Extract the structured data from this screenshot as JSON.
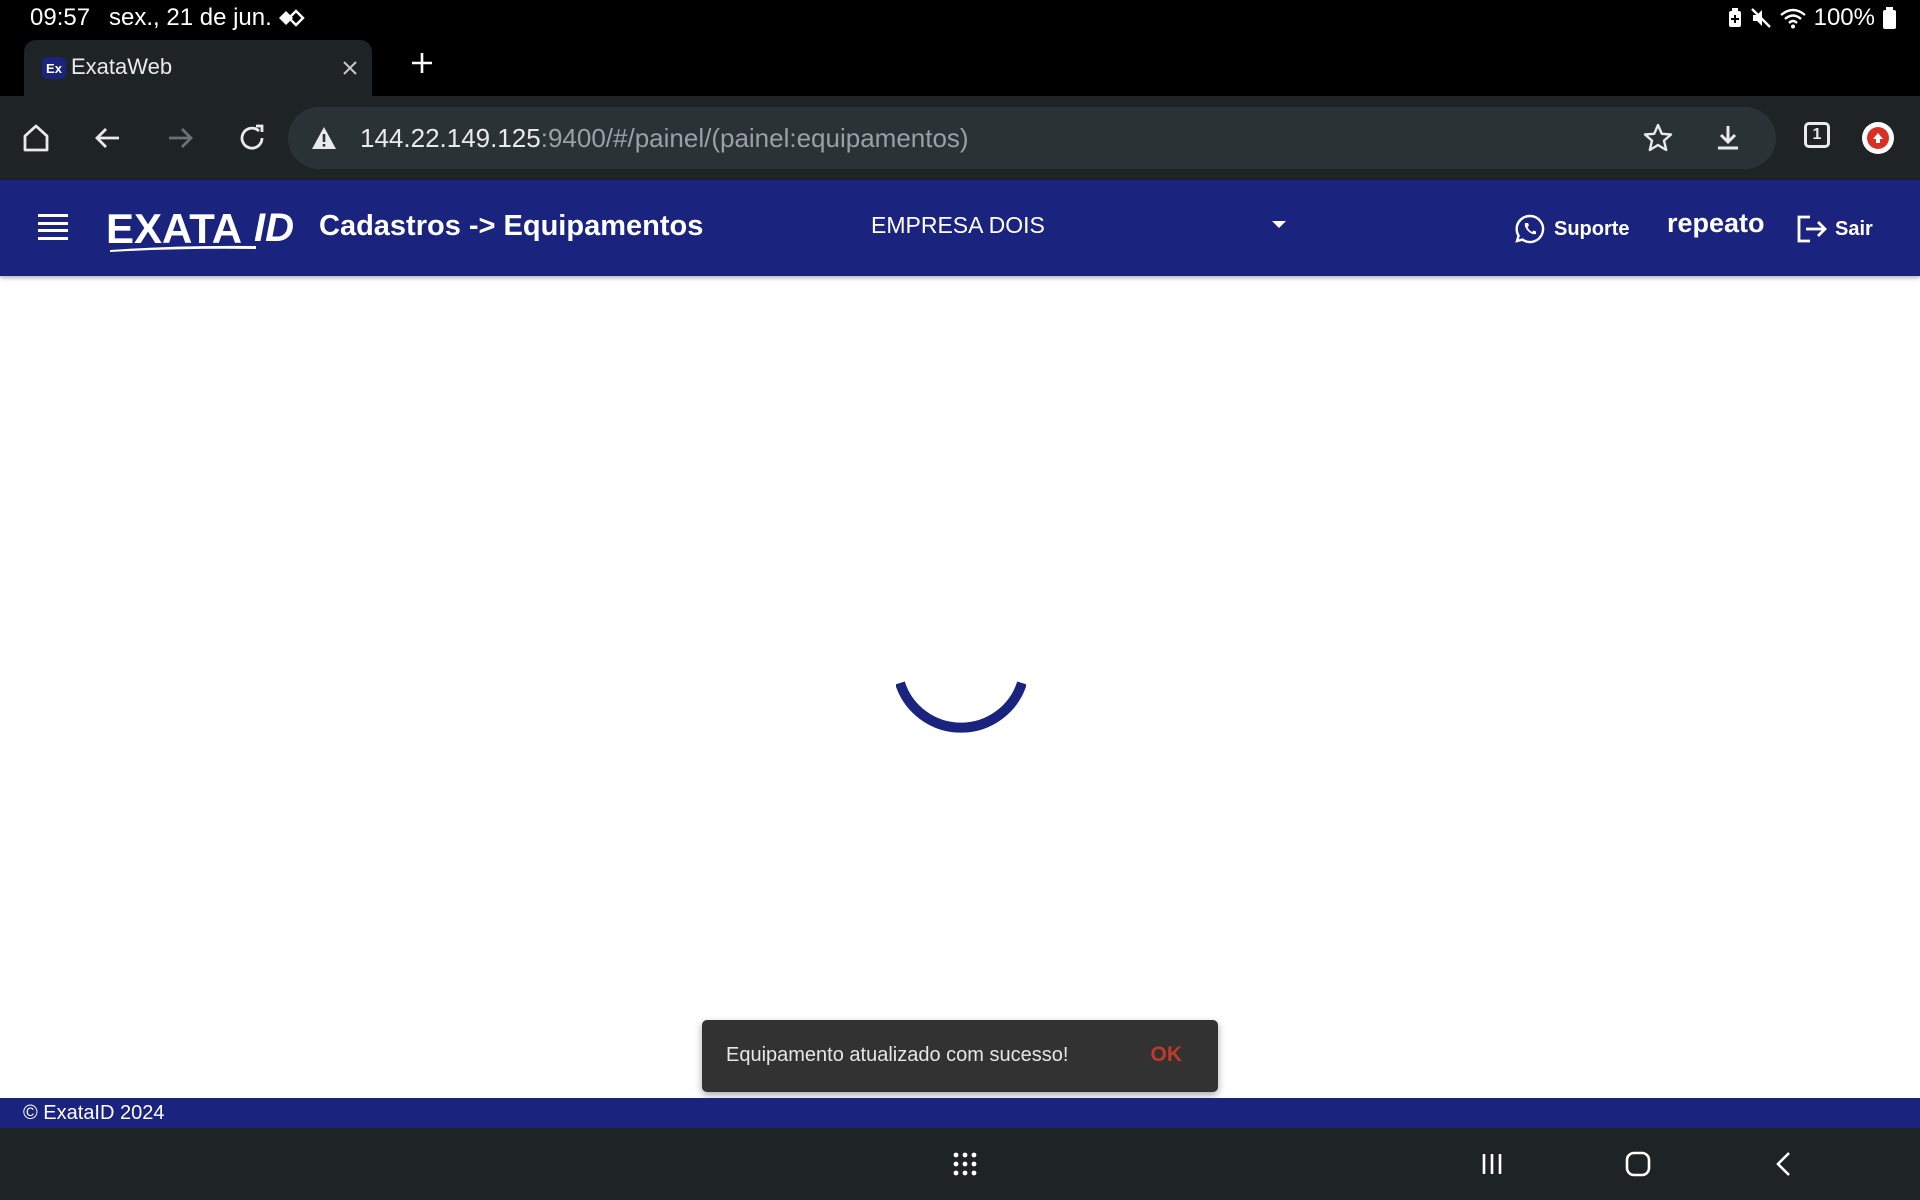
{
  "status_bar": {
    "time": "09:57",
    "date": "sex., 21 de jun.",
    "battery": "100%",
    "icons": [
      "diamond-icon",
      "battery-saver-icon",
      "mute-icon",
      "wifi-icon",
      "battery-icon"
    ]
  },
  "browser": {
    "tab": {
      "favicon_text": "Ex",
      "title": "ExataWeb"
    },
    "url": {
      "host": "144.22.149.125",
      "path": ":9400/#/painel/(painel:equipamentos)"
    },
    "tabs_count": "1",
    "colors": {
      "chrome_bg": "#1e2326",
      "omnibox_bg": "#2b3236"
    }
  },
  "app": {
    "logo": {
      "part1": "EXATA",
      "part2": "ID"
    },
    "page_title": "Cadastros -> Equipamentos",
    "company_select": {
      "value": "EMPRESA DOIS"
    },
    "support_label": "Suporte",
    "username": "repeato",
    "logout_label": "Sair",
    "footer": "© ExataID 2024",
    "colors": {
      "primary": "#1a237e",
      "snackbar_bg": "#323232",
      "snackbar_action": "#c0392b"
    }
  },
  "snackbar": {
    "message": "Equipamento atualizado com sucesso!",
    "action": "OK"
  }
}
